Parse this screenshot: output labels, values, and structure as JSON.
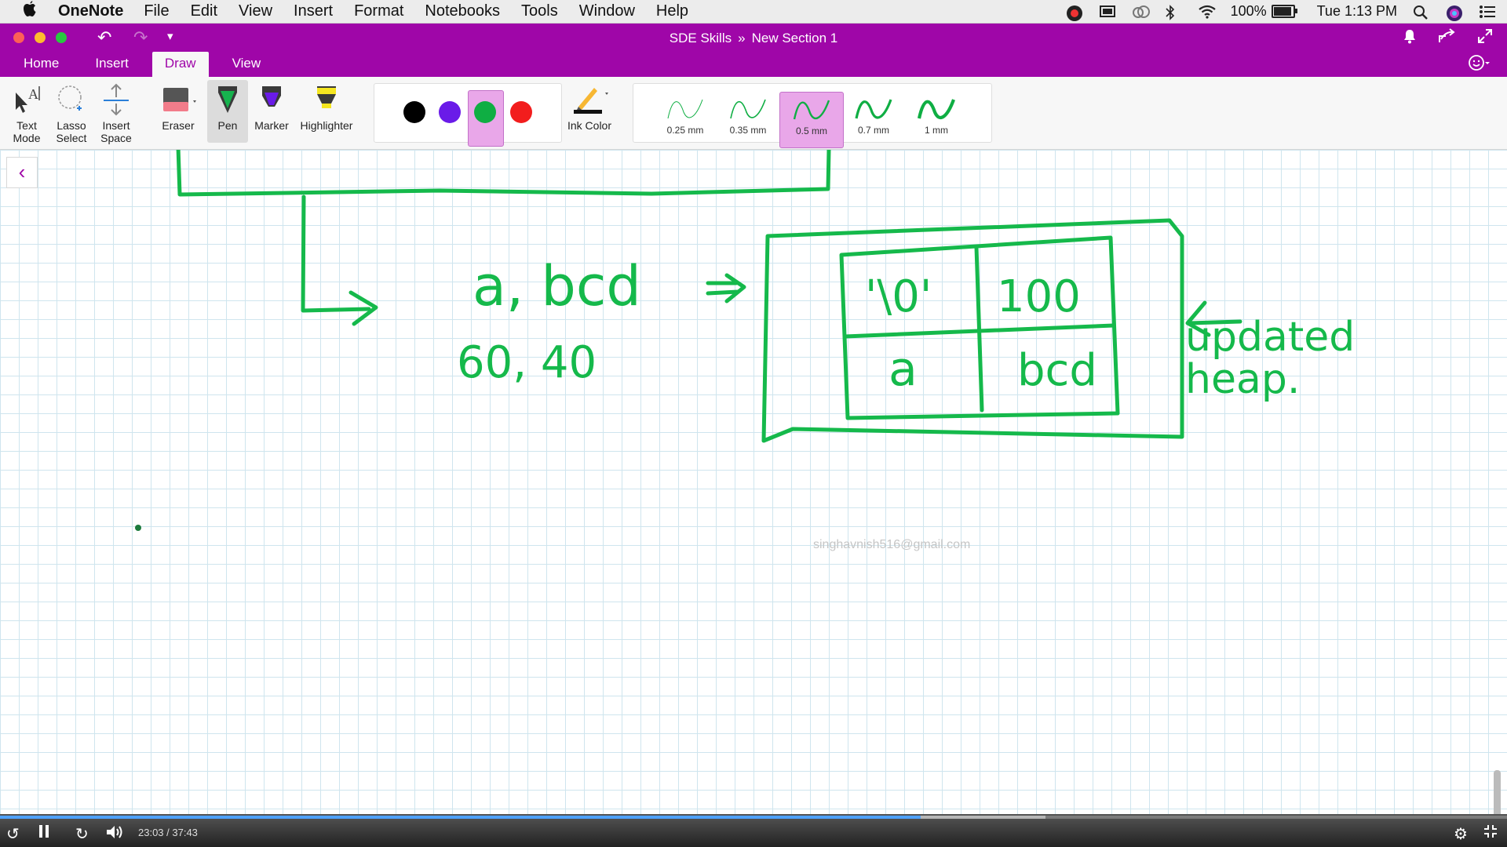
{
  "menubar": {
    "app_name": "OneNote",
    "items": [
      "File",
      "Edit",
      "View",
      "Insert",
      "Format",
      "Notebooks",
      "Tools",
      "Window",
      "Help"
    ],
    "battery": "100%",
    "battery_level": 1.0,
    "clock": "Tue 1:13 PM"
  },
  "window": {
    "notebook": "SDE Skills",
    "separator": "»",
    "section": "New Section 1"
  },
  "tabs": [
    {
      "label": "Home",
      "active": false
    },
    {
      "label": "Insert",
      "active": false
    },
    {
      "label": "Draw",
      "active": true
    },
    {
      "label": "View",
      "active": false
    }
  ],
  "ribbon": {
    "text_mode": "Text\nMode",
    "lasso_select": "Lasso\nSelect",
    "insert_space": "Insert\nSpace",
    "eraser": "Eraser",
    "pen": "Pen",
    "marker": "Marker",
    "highlighter": "Highlighter",
    "ink_color": "Ink Color",
    "colors": [
      {
        "name": "black",
        "hex": "#000000",
        "selected": false
      },
      {
        "name": "purple",
        "hex": "#6a1be8",
        "selected": false
      },
      {
        "name": "green",
        "hex": "#0fae43",
        "selected": true
      },
      {
        "name": "red",
        "hex": "#f21d1d",
        "selected": false
      }
    ],
    "thickness": [
      {
        "label": "0.25 mm",
        "selected": false
      },
      {
        "label": "0.35 mm",
        "selected": false
      },
      {
        "label": "0.5 mm",
        "selected": true
      },
      {
        "label": "0.7 mm",
        "selected": false
      },
      {
        "label": "1 mm",
        "selected": false
      }
    ]
  },
  "canvas": {
    "watermark": "singhavnish516@gmail.com",
    "ink_color": "#15b94b",
    "handwriting": {
      "pair": "a, bcd",
      "numbers": "60, 40",
      "arrow": "=>",
      "heap_cells": [
        "'\\0'",
        "100",
        "a",
        "bcd"
      ],
      "note": "updated heap."
    }
  },
  "video": {
    "time": "23:03 / 37:43",
    "played_fraction": 0.611,
    "buffered_fraction": 0.694
  },
  "colors": {
    "accent": "#9f06a8",
    "ink": "#15b94b",
    "grid": "#cfe5ee"
  }
}
